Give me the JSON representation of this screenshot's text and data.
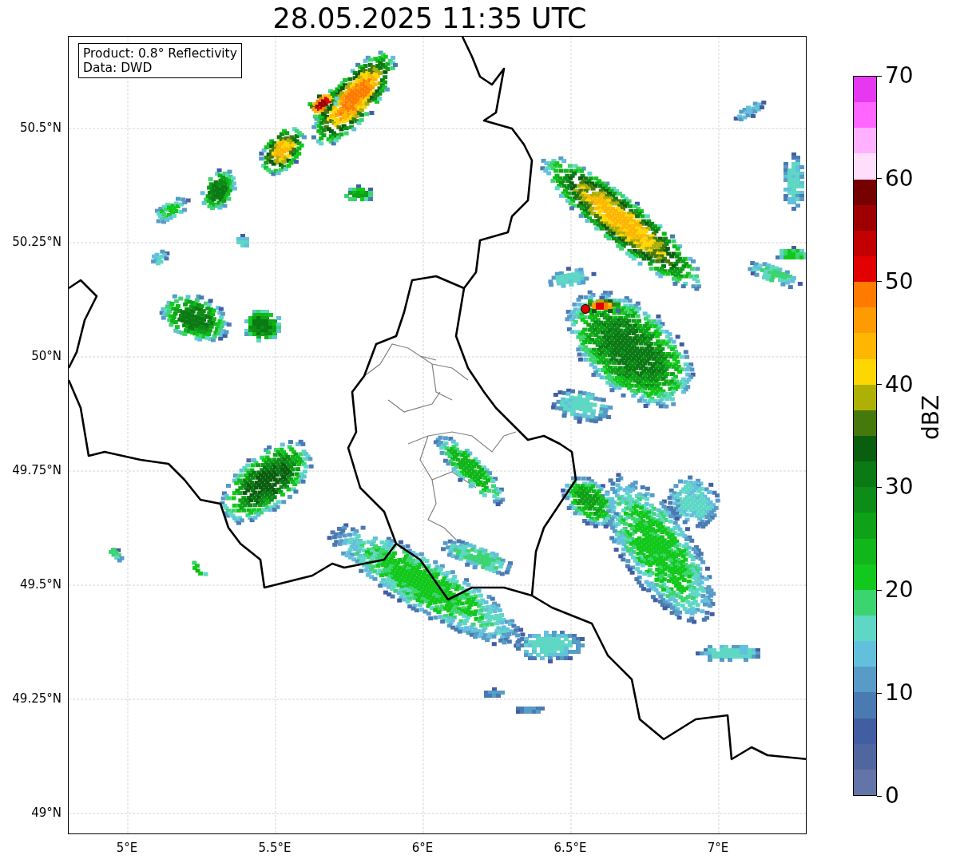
{
  "title": "28.05.2025 11:35 UTC",
  "info": [
    "Product: 0.8° Reflectivity",
    "Data: DWD"
  ],
  "lat_ticks": [
    "50.5°N",
    "50.25°N",
    "50°N",
    "49.75°N",
    "49.5°N",
    "49.25°N",
    "49°N"
  ],
  "lon_ticks": [
    "5°E",
    "5.5°E",
    "6°E",
    "6.5°E",
    "7°E"
  ],
  "colorbar": {
    "label": "dBZ",
    "ticks": [
      "70",
      "60",
      "50",
      "40",
      "30",
      "20",
      "10",
      "0"
    ],
    "bands": [
      {
        "color": "#6374a8"
      },
      {
        "color": "#50669f"
      },
      {
        "color": "#425ea2"
      },
      {
        "color": "#4a7ab2"
      },
      {
        "color": "#579bc6"
      },
      {
        "color": "#63c0dc"
      },
      {
        "color": "#5ed8c4"
      },
      {
        "color": "#3cd470"
      },
      {
        "color": "#12c81c"
      },
      {
        "color": "#10b61a"
      },
      {
        "color": "#0fa118"
      },
      {
        "color": "#0d8c17"
      },
      {
        "color": "#0b7a15"
      },
      {
        "color": "#0a5e0f"
      },
      {
        "color": "#45790c"
      },
      {
        "color": "#aeb006"
      },
      {
        "color": "#fed700"
      },
      {
        "color": "#feb700"
      },
      {
        "color": "#fe9b00"
      },
      {
        "color": "#fe7b00"
      },
      {
        "color": "#e20000"
      },
      {
        "color": "#c20000"
      },
      {
        "color": "#9e0000"
      },
      {
        "color": "#760000"
      },
      {
        "color": "#ffdefc"
      },
      {
        "color": "#ffb1ff"
      },
      {
        "color": "#ff66ff"
      },
      {
        "color": "#e638f0"
      }
    ]
  }
}
